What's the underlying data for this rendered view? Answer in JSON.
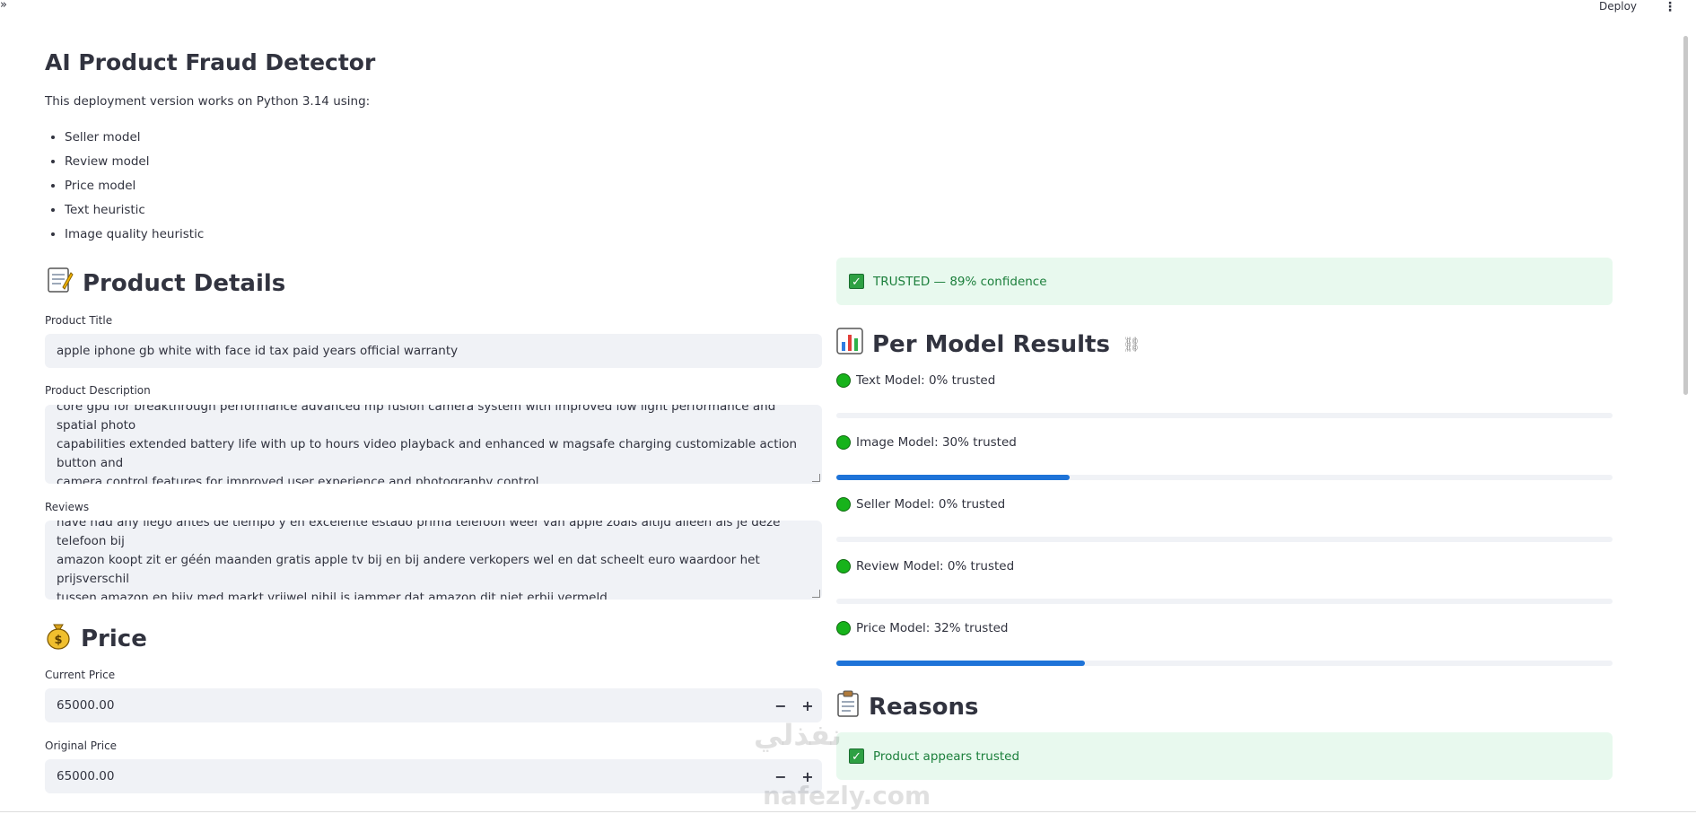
{
  "topbar": {
    "collapse_label": "»",
    "deploy_label": "Deploy",
    "menu_glyph": "⋮"
  },
  "header": {
    "title": "AI Product Fraud Detector",
    "intro": "This deployment version works on Python 3.14 using:",
    "bullets": [
      "Seller model",
      "Review model",
      "Price model",
      "Text heuristic",
      "Image quality heuristic"
    ]
  },
  "product_details": {
    "heading": "Product Details",
    "heading_icon": "memo-icon",
    "title_label": "Product Title",
    "title_value": "apple iphone gb white with face id tax paid years official warranty",
    "description_label": "Product Description",
    "description_lines": [
      "core gpu for breakthrough performance advanced mp fusion camera system with improved low light performance and spatial photo",
      "capabilities extended battery life with up to hours video playback and enhanced w magsafe charging customizable action button and",
      "camera control features for improved user experience and photography control"
    ],
    "reviews_label": "Reviews",
    "reviews_lines": [
      "have had any llego antes de tiempo y en excelente estado prima telefoon weer van apple zoals altijd alleen als je deze telefoon bij",
      "amazon koopt zit er géén maanden gratis apple tv bij en bij andere verkopers wel en dat scheelt euro waardoor het prijsverschil",
      "tussen amazon en bijv med markt vrijwel nihil is jammer dat amazon dit niet erbij vermeld"
    ]
  },
  "price": {
    "heading": "Price",
    "heading_icon": "money-bag-icon",
    "current_label": "Current Price",
    "current_value": "65000.00",
    "original_label": "Original Price",
    "original_value": "65000.00",
    "minus": "−",
    "plus": "+"
  },
  "result": {
    "status_text": "TRUSTED — 89% confidence",
    "check_glyph": "✓"
  },
  "per_model": {
    "heading": "Per Model Results",
    "heading_icon": "bar-chart-icon",
    "link_glyph": "⛓",
    "models": [
      {
        "label": "Text Model: 0% trusted",
        "trust": 0
      },
      {
        "label": "Image Model: 30% trusted",
        "trust": 0.3
      },
      {
        "label": "Seller Model: 0% trusted",
        "trust": 0
      },
      {
        "label": "Review Model: 0% trusted",
        "trust": 0
      },
      {
        "label": "Price Model: 32% trusted",
        "trust": 0.32
      }
    ]
  },
  "reasons": {
    "heading": "Reasons",
    "heading_icon": "clipboard-icon",
    "items": [
      "Product appears trusted"
    ]
  },
  "watermark": {
    "line1": "نفذلي",
    "line2": "nafezly.com"
  },
  "colors": {
    "accent": "#1e73d8",
    "success_bg": "#e8f9ee",
    "success_text": "#1b7f3b",
    "input_bg": "#f0f2f6",
    "dot_green": "#17b31b"
  }
}
